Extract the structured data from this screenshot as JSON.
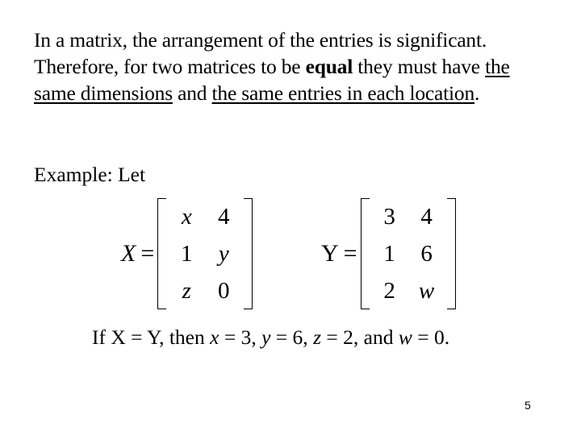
{
  "paragraph": {
    "part1": "In a matrix, the arrangement of the entries is significant. Therefore, for two matrices to be ",
    "bold": "equal",
    "part2": " they must have ",
    "underline1": "the same dimensions",
    "part3": " and ",
    "underline2": "the same entries in each location",
    "part4": "."
  },
  "example_label": "Example: Let",
  "matrix_x": {
    "name": "X",
    "equals": "=",
    "cells": [
      [
        "x",
        "4"
      ],
      [
        "1",
        "y"
      ],
      [
        "z",
        "0"
      ]
    ]
  },
  "matrix_y": {
    "name": "Y",
    "equals": "=",
    "cells": [
      [
        "3",
        "4"
      ],
      [
        "1",
        "6"
      ],
      [
        "2",
        "w"
      ]
    ]
  },
  "conclusion": {
    "t1": "If X = Y, then ",
    "v1": "x",
    "t2": " = 3, ",
    "v2": "y",
    "t3": " = 6, ",
    "v3": "z",
    "t4": " = 2, and ",
    "v4": "w",
    "t5": " = 0."
  },
  "page_number": "5"
}
